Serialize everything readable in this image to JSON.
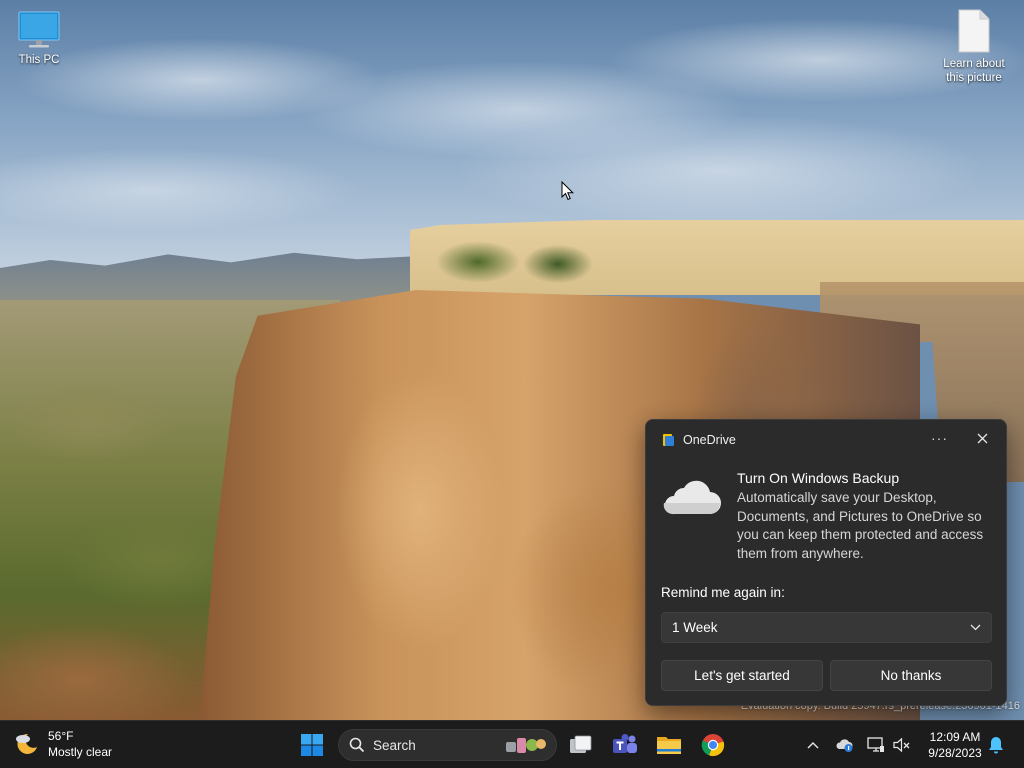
{
  "desktop": {
    "icons": [
      {
        "label": "This PC",
        "icon": "monitor-icon"
      },
      {
        "label": "Learn about this picture",
        "icon": "document-icon"
      }
    ],
    "watermark": "Evaluation copy. Build 25947.rs_prerelease.230901-1416"
  },
  "toast": {
    "app_name": "OneDrive",
    "more_label": "···",
    "title": "Turn On Windows Backup",
    "body": "Automatically save your Desktop, Documents, and Pictures to OneDrive so you can keep them protected and access them from anywhere.",
    "remind_label": "Remind me again in:",
    "remind_selected": "1 Week",
    "primary_button": "Let's get started",
    "secondary_button": "No thanks"
  },
  "taskbar": {
    "weather": {
      "temp": "56°F",
      "condition": "Mostly clear"
    },
    "search_placeholder": "Search",
    "apps": [
      "start-icon",
      "task-view-icon",
      "teams-icon",
      "file-explorer-icon",
      "chrome-icon"
    ],
    "tray": [
      "chevron-up-icon",
      "onedrive-tray-icon",
      "network-icon",
      "volume-muted-icon",
      "notifications-icon"
    ],
    "time": "12:09 AM",
    "date": "9/28/2023"
  },
  "colors": {
    "taskbar_bg": "#1c1c1c",
    "toast_bg": "#2b2b2b",
    "control_bg": "#373737",
    "accent": "#0078d4"
  }
}
